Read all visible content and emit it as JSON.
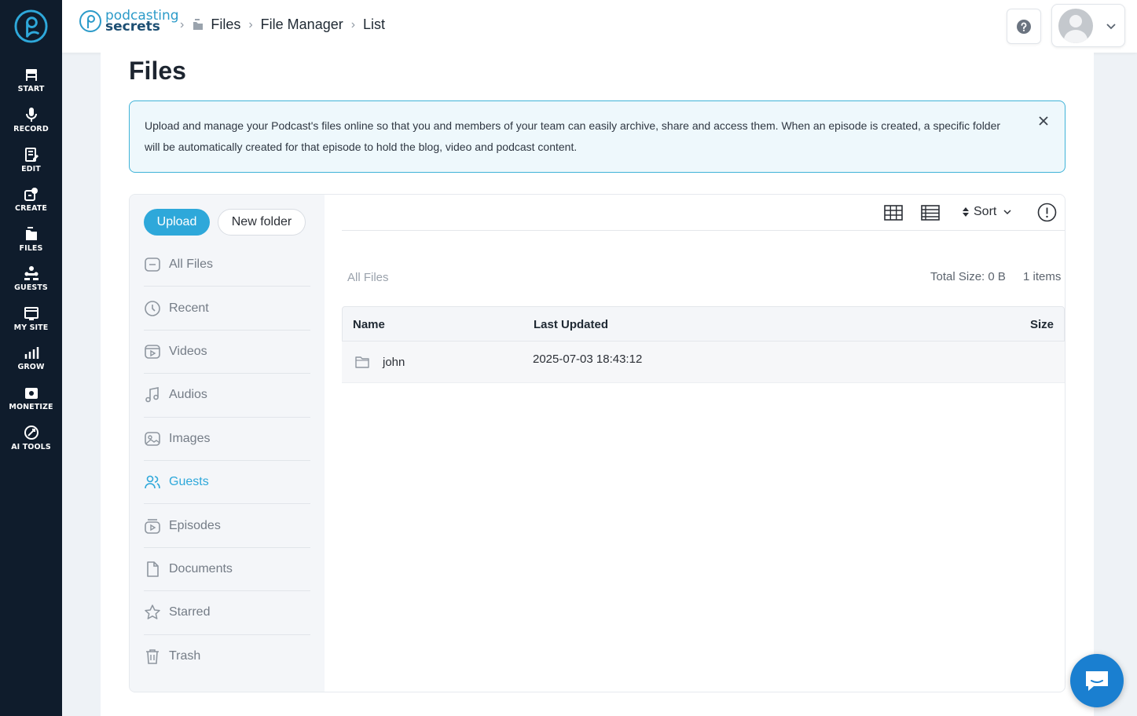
{
  "rail": {
    "items": [
      {
        "label": "START",
        "icon": "start-icon"
      },
      {
        "label": "RECORD",
        "icon": "microphone-icon"
      },
      {
        "label": "EDIT",
        "icon": "edit-icon"
      },
      {
        "label": "CREATE",
        "icon": "create-icon"
      },
      {
        "label": "FILES",
        "icon": "files-icon"
      },
      {
        "label": "GUESTS",
        "icon": "guests-icon"
      },
      {
        "label": "MY SITE",
        "icon": "site-icon"
      },
      {
        "label": "GROW",
        "icon": "chart-icon"
      },
      {
        "label": "MONETIZE",
        "icon": "money-icon"
      },
      {
        "label": "AI TOOLS",
        "icon": "ai-icon"
      }
    ]
  },
  "header": {
    "brand_line1": "podcasting",
    "brand_line2": "secrets",
    "breadcrumbs": [
      "Files",
      "File Manager",
      "List"
    ]
  },
  "page": {
    "title": "Files",
    "alert": "Upload and manage your Podcast's files online so that you and members of your team can easily archive, share and access them. When an episode is created, a specific folder will be automatically created for that episode to hold the blog, video and podcast content."
  },
  "sidebar": {
    "upload_label": "Upload",
    "new_folder_label": "New folder",
    "items": [
      {
        "label": "All Files",
        "icon": "folder-icon"
      },
      {
        "label": "Recent",
        "icon": "clock-icon"
      },
      {
        "label": "Videos",
        "icon": "video-icon"
      },
      {
        "label": "Audios",
        "icon": "music-icon"
      },
      {
        "label": "Images",
        "icon": "image-icon"
      },
      {
        "label": "Guests",
        "icon": "users-icon",
        "active": true
      },
      {
        "label": "Episodes",
        "icon": "episodes-icon"
      },
      {
        "label": "Documents",
        "icon": "document-icon"
      },
      {
        "label": "Starred",
        "icon": "star-icon"
      },
      {
        "label": "Trash",
        "icon": "trash-icon"
      }
    ]
  },
  "toolbar": {
    "sort_label": "Sort"
  },
  "listing": {
    "path_label": "All Files",
    "total_size": "Total Size: 0 B",
    "count": "1 items",
    "columns": {
      "name": "Name",
      "updated": "Last Updated",
      "size": "Size"
    },
    "rows": [
      {
        "name": "john",
        "updated": "2025-07-03 18:43:12",
        "size": ""
      }
    ]
  },
  "colors": {
    "rail_bg": "#0f1c2c",
    "accent": "#2ea8da",
    "alert_border": "#3fb3d8",
    "chat": "#1a7fd0"
  }
}
